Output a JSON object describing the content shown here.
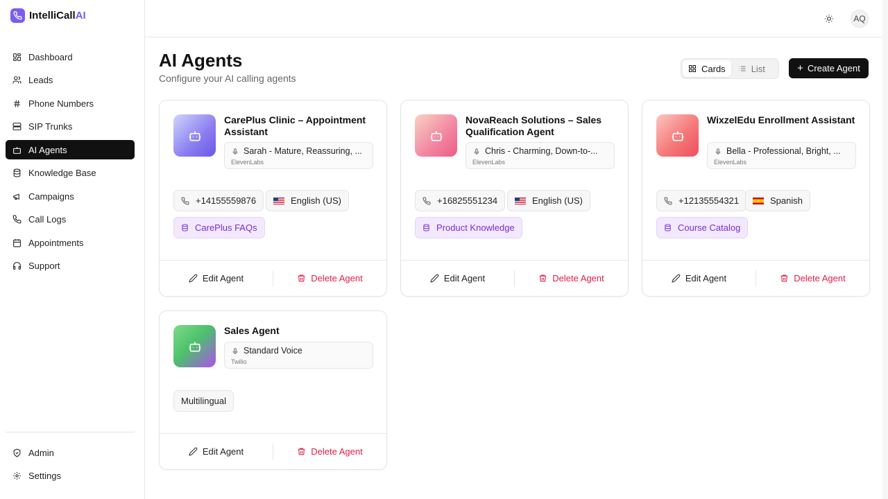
{
  "app": {
    "brand_main": "IntelliCall",
    "brand_accent": "AI"
  },
  "sidebar": {
    "items": [
      {
        "label": "Dashboard",
        "icon": "grid-icon"
      },
      {
        "label": "Leads",
        "icon": "users-icon"
      },
      {
        "label": "Phone Numbers",
        "icon": "hash-icon"
      },
      {
        "label": "SIP Trunks",
        "icon": "server-icon"
      },
      {
        "label": "AI Agents",
        "icon": "bot-icon",
        "active": true
      },
      {
        "label": "Knowledge Base",
        "icon": "database-icon"
      },
      {
        "label": "Campaigns",
        "icon": "megaphone-icon"
      },
      {
        "label": "Call Logs",
        "icon": "phone-icon"
      },
      {
        "label": "Appointments",
        "icon": "calendar-icon"
      },
      {
        "label": "Support",
        "icon": "headphones-icon"
      }
    ],
    "bottom_items": [
      {
        "label": "Admin",
        "icon": "shield-icon"
      },
      {
        "label": "Settings",
        "icon": "gear-icon"
      }
    ]
  },
  "header": {
    "avatar_initials": "AQ",
    "theme_icon": "sun-icon"
  },
  "page": {
    "title": "AI Agents",
    "subtitle": "Configure your AI calling agents",
    "view_cards": "Cards",
    "view_list": "List",
    "create_button": "Create Agent"
  },
  "colors": {
    "accent": "#7b5cf0",
    "danger": "#e11d48",
    "kb_text": "#7a2bd6",
    "kb_bg": "#f3e9fd"
  },
  "agents": [
    {
      "name": "CarePlus Clinic – Appointment Assistant",
      "voice": "Sarah - Mature, Reassuring, ...",
      "provider": "ElevenLabs",
      "phone": "+14155559876",
      "language": "English (US)",
      "flag": "us",
      "knowledge_base": "CarePlus FAQs",
      "edit_label": "Edit Agent",
      "delete_label": "Delete Agent"
    },
    {
      "name": "NovaReach Solutions – Sales Qualification Agent",
      "voice": "Chris - Charming, Down-to-...",
      "provider": "ElevenLabs",
      "phone": "+16825551234",
      "language": "English (US)",
      "flag": "us",
      "knowledge_base": "Product Knowledge",
      "edit_label": "Edit Agent",
      "delete_label": "Delete Agent"
    },
    {
      "name": "WixzelEdu Enrollment Assistant",
      "voice": "Bella - Professional, Bright, ...",
      "provider": "ElevenLabs",
      "phone": "+12135554321",
      "language": "Spanish",
      "flag": "es",
      "knowledge_base": "Course Catalog",
      "edit_label": "Edit Agent",
      "delete_label": "Delete Agent"
    },
    {
      "name": "Sales Agent",
      "voice": "Standard Voice",
      "provider": "Twilio",
      "language": "Multilingual",
      "edit_label": "Edit Agent",
      "delete_label": "Delete Agent"
    }
  ]
}
